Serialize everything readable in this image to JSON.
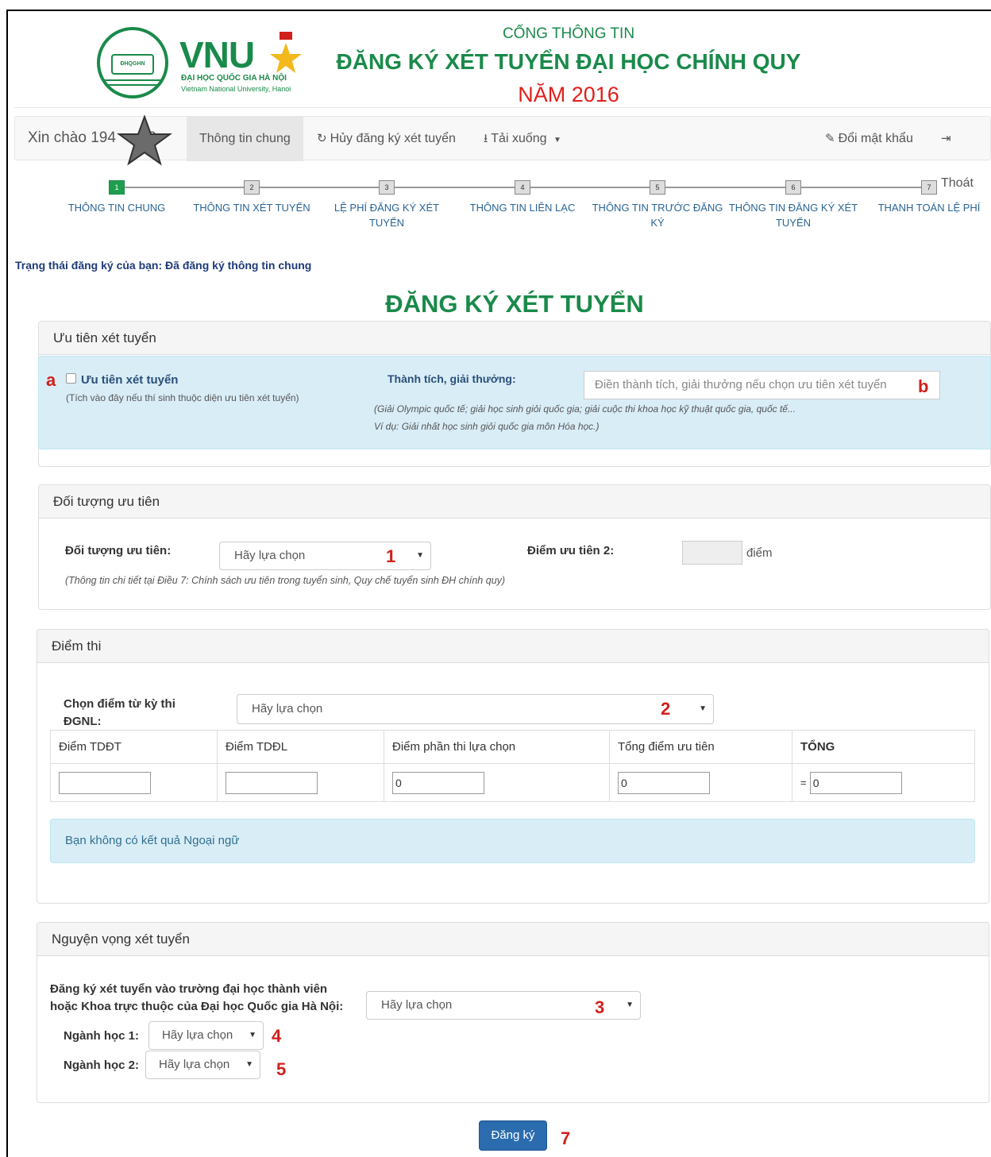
{
  "header": {
    "logo_small": "ĐHQGHN",
    "brand": "VNU",
    "brand_sub1": "ĐẠI HỌC QUỐC GIA HÀ NỘI",
    "brand_sub2": "Vietnam National University, Hanoi",
    "title_line1": "CỔNG THÔNG TIN",
    "title_line2": "ĐĂNG KÝ XÉT TUYỂN ĐẠI HỌC CHÍNH QUY",
    "title_line3": "NĂM 2016"
  },
  "navbar": {
    "greeting_prefix": "Xin chào 194",
    "greeting_suffix": "49",
    "items": [
      {
        "label": "Thông tin chung",
        "icon": ""
      },
      {
        "label": "Hủy đăng ký xét tuyển",
        "icon": "refresh-icon"
      },
      {
        "label": "Tải xuống",
        "icon": "download-icon"
      },
      {
        "label": "Đổi mật khẩu",
        "icon": "edit-icon"
      },
      {
        "label": "Thoát",
        "icon": "logout-icon"
      }
    ]
  },
  "steps": [
    {
      "num": "1",
      "label": "THÔNG TIN CHUNG"
    },
    {
      "num": "2",
      "label": "THÔNG TIN XÉT TUYỂN"
    },
    {
      "num": "3",
      "label": "LỆ PHÍ ĐĂNG KÝ XÉT TUYỂN"
    },
    {
      "num": "4",
      "label": "THÔNG TIN LIÊN LẠC"
    },
    {
      "num": "5",
      "label": "THÔNG TIN TRƯỚC ĐĂNG KÝ"
    },
    {
      "num": "6",
      "label": "THÔNG TIN ĐĂNG KÝ XÉT TUYỂN"
    },
    {
      "num": "7",
      "label": "THANH TOÁN LỆ PHÍ"
    }
  ],
  "status": "Trạng thái đăng ký của bạn: Đã đăng ký thông tin chung",
  "main_title": "ĐĂNG KÝ XÉT TUYỂN",
  "priority_panel": {
    "heading": "Ưu tiên xét tuyển",
    "checkbox_label": "Ưu tiên xét tuyển",
    "checkbox_hint": "(Tích vào đây nếu thí sinh thuộc diện ưu tiên xét tuyển)",
    "achievement_label": "Thành tích, giải thưởng:",
    "achievement_placeholder": "Điền thành tích, giải thưởng nếu chọn ưu tiên xét tuyển",
    "achievement_hint1": "(Giải Olympic quốc tế; giải học sinh giỏi quốc gia; giải cuộc thi khoa học kỹ thuật quốc gia, quốc tế...",
    "achievement_hint2": "Ví dụ: Giải nhất học sinh giỏi quốc gia môn Hóa học.)",
    "mark_a": "a",
    "mark_b": "b"
  },
  "target_panel": {
    "heading": "Đối tượng ưu tiên",
    "target_label": "Đối tượng ưu tiên:",
    "target_select": "Hãy lựa chọn",
    "target_hint": "(Thông tin chi tiết tại Điều 7: Chính sách ưu tiên trong tuyển sinh, Quy chế tuyển sinh ĐH chính quy)",
    "score2_label": "Điểm ưu tiên 2:",
    "score2_value": "",
    "score2_unit": "điểm",
    "mark": "1"
  },
  "exam_panel": {
    "heading": "Điểm thi",
    "select_label": "Chọn điểm từ kỳ thi ĐGNL:",
    "select_value": "Hãy lựa chọn",
    "mark": "2",
    "columns": [
      "Điểm TDĐT",
      "Điểm TDĐL",
      "Điểm phần thi lựa chọn",
      "Tổng điểm ưu tiên",
      "TỔNG"
    ],
    "values": [
      "",
      "",
      "0",
      "0",
      "0"
    ],
    "equals": "=",
    "foreign_lang_notice": "Bạn không có kết quả Ngoại ngữ"
  },
  "wish_panel": {
    "heading": "Nguyện vọng xét tuyển",
    "school_label_line1": "Đăng ký xét tuyển vào trường đại học thành viên",
    "school_label_line2": "hoặc Khoa trực thuộc của Đại học Quốc gia Hà Nội:",
    "school_select": "Hãy lựa chọn",
    "major1_label": "Ngành học 1:",
    "major1_select": "Hãy lựa chọn",
    "major2_label": "Ngành học 2:",
    "major2_select": "Hãy lựa chọn",
    "mark3": "3",
    "mark4": "4",
    "mark5": "5"
  },
  "submit": {
    "label": "Đăng ký",
    "mark": "7"
  },
  "colors": {
    "brand_green": "#1a8a4a",
    "accent_red": "#e0201c",
    "primary_blue": "#2a6cae",
    "info_bg": "#d9edf7"
  }
}
